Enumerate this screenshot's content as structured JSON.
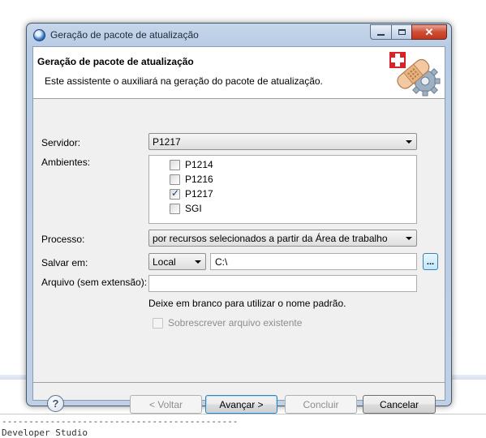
{
  "background": {
    "console_dashes": "--------------------------------------------",
    "console_text": "Developer Studio"
  },
  "window": {
    "title": "Geração de pacote de atualização",
    "controls": {
      "minimize_icon": "minimize-icon",
      "maximize_icon": "maximize-icon",
      "close_icon": "close-icon"
    }
  },
  "header": {
    "title": "Geração de pacote de atualização",
    "description": "Este assistente o auxiliará na geração do pacote de atualização.",
    "art_icon": "patch-gear-icon"
  },
  "form": {
    "servidor_label": "Servidor:",
    "servidor_value": "P1217",
    "ambientes_label": "Ambientes:",
    "ambientes": [
      {
        "label": "P1214",
        "checked": false
      },
      {
        "label": "P1216",
        "checked": false
      },
      {
        "label": "P1217",
        "checked": true
      },
      {
        "label": "SGI",
        "checked": false
      }
    ],
    "processo_label": "Processo:",
    "processo_value": "por recursos selecionados a partir da Área de trabalho",
    "salvar_label": "Salvar em:",
    "salvar_location": "Local",
    "salvar_path": "C:\\",
    "browse_label": "...",
    "arquivo_label": "Arquivo (sem extensão):",
    "arquivo_value": "",
    "hint": "Deixe em branco para utilizar o nome padrão.",
    "overwrite_label": "Sobrescrever arquivo existente",
    "overwrite_checked": false
  },
  "footer": {
    "help_label": "?",
    "back_label": "< Voltar",
    "next_label": "Avançar >",
    "finish_label": "Concluir",
    "cancel_label": "Cancelar"
  }
}
